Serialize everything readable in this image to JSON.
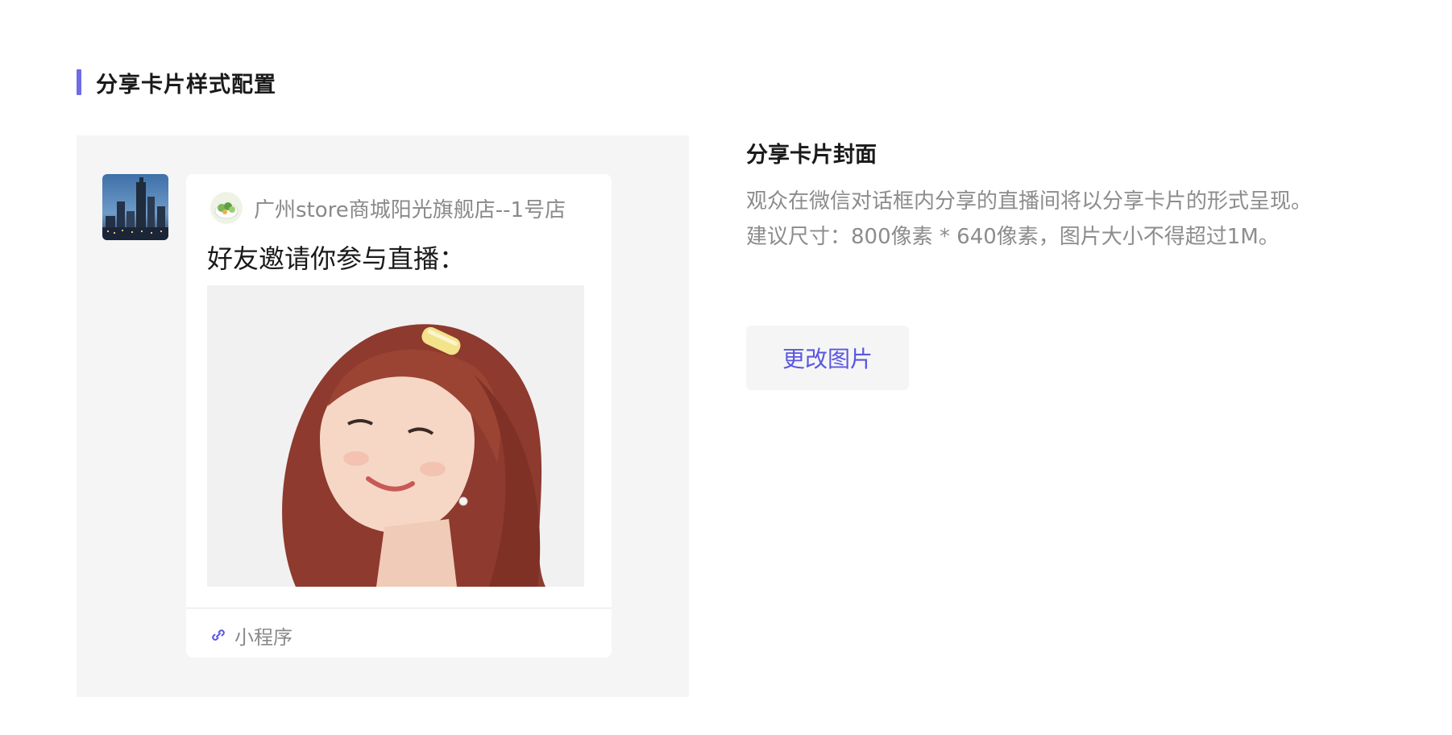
{
  "section": {
    "title": "分享卡片样式配置"
  },
  "preview": {
    "shop_name": "广州store商城阳光旗舰店--1号店",
    "card_title": "好友邀请你参与直播：",
    "footer_label": "小程序",
    "footer_icon": "link-icon"
  },
  "info": {
    "title": "分享卡片封面",
    "desc_line1": "观众在微信对话框内分享的直播间将以分享卡片的形式呈现。",
    "desc_line2": "建议尺寸：800像素 * 640像素，图片大小不得超过1M。"
  },
  "actions": {
    "change_image_label": "更改图片"
  },
  "colors": {
    "accent": "#6f6ce6",
    "panel_bg": "#f5f5f5",
    "muted_text": "#8c8c8c"
  }
}
